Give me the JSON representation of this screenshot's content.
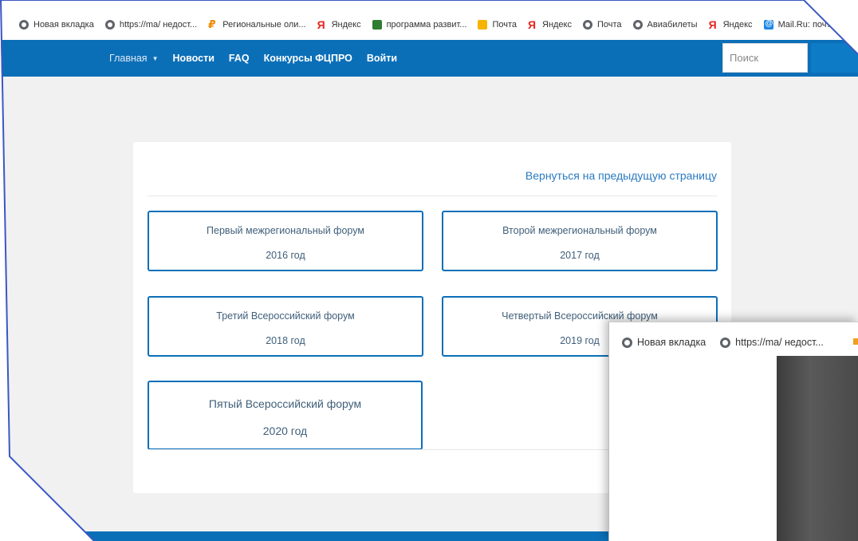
{
  "bookmarks": [
    {
      "icon": "globe-icon",
      "label": "Новая вкладка"
    },
    {
      "icon": "globe-icon",
      "label": "https://ma/ недост..."
    },
    {
      "icon": "olympiad-icon",
      "label": "Региональные оли..."
    },
    {
      "icon": "yandex-icon",
      "label": "Яндекс"
    },
    {
      "icon": "program-icon",
      "label": "программа развит..."
    },
    {
      "icon": "mail-icon",
      "label": "Почта"
    },
    {
      "icon": "yandex-icon",
      "label": "Яндекс"
    },
    {
      "icon": "globe-icon",
      "label": "Почта"
    },
    {
      "icon": "globe-icon",
      "label": "Авиабилеты"
    },
    {
      "icon": "yandex-icon",
      "label": "Яндекс"
    },
    {
      "icon": "mailru-icon",
      "label": "Mail.Ru: почта, пои..."
    }
  ],
  "nav": {
    "home": "Главная",
    "news": "Новости",
    "faq": "FAQ",
    "contests": "Конкурсы ФЦПРО",
    "login": "Войти"
  },
  "search": {
    "placeholder": "Поиск"
  },
  "back_link": "Вернуться на предыдущую страницу",
  "forums": [
    {
      "title": "Первый межрегиональный форум",
      "year": "2016 год"
    },
    {
      "title": "Второй межрегиональный форум",
      "year": "2017 год"
    },
    {
      "title": "Третий Всероссийский форум",
      "year": "2018 год"
    },
    {
      "title": "Четвертый Всероссийский форум",
      "year": "2019 год"
    },
    {
      "title": "Пятый Всероссийский форум",
      "year": "2020 год"
    }
  ],
  "window2": {
    "bookmarks": [
      {
        "icon": "globe-icon",
        "label": "Новая вкладка"
      },
      {
        "icon": "globe-icon",
        "label": "https://ma/ недост..."
      }
    ]
  },
  "colors": {
    "accent": "#0b6fb8",
    "link": "#2a7ac0",
    "frame": "#3b57c4"
  }
}
